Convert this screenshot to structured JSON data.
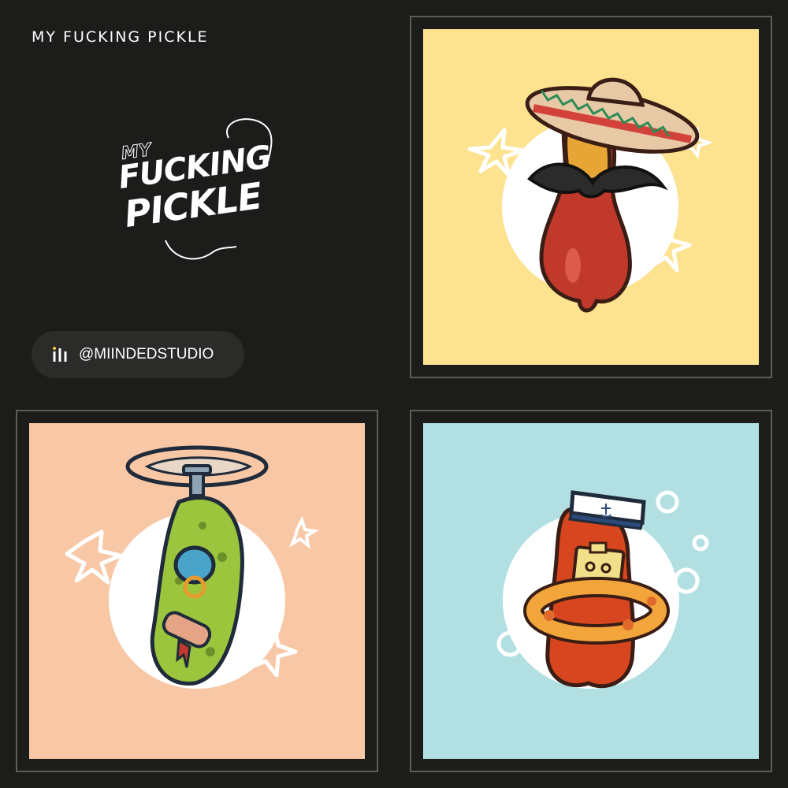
{
  "header": {
    "title": "MY FUCKING PICKLE"
  },
  "logo": {
    "line1": "MY",
    "line2": "FUCKING",
    "line3": "PICKLE"
  },
  "social": {
    "handle": "@MIINDEDSTUDIO",
    "icon": "studio-logo-icon"
  },
  "cards": [
    {
      "subject": "sombrero-pickle",
      "background": "#fde28f"
    },
    {
      "subject": "propeller-pickle",
      "background": "#f8c8a6"
    },
    {
      "subject": "sailor-pickle",
      "background": "#b2e0e2"
    }
  ]
}
